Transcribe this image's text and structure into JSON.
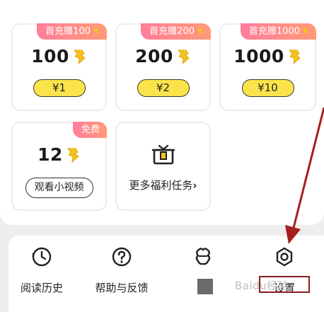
{
  "recharge_cards": [
    {
      "badge": "首充赠100",
      "amount": "100",
      "price": "¥1"
    },
    {
      "badge": "首充赠200",
      "amount": "200",
      "price": "¥2"
    },
    {
      "badge": "首充赠1000",
      "amount": "1000",
      "price": "¥10"
    }
  ],
  "video_card": {
    "badge": "免费",
    "amount": "12",
    "button": "观看小视频"
  },
  "tasks_card": {
    "label": "更多福利任务",
    "chevron": "›"
  },
  "bottom_nav": [
    {
      "label": "阅读历史",
      "icon": "history-icon"
    },
    {
      "label": "帮助与反馈",
      "icon": "help-icon"
    },
    {
      "label": "",
      "icon": "skin-icon"
    },
    {
      "label": "设置",
      "icon": "settings-icon"
    }
  ],
  "annotation": {
    "watermark": "Baidu经验",
    "arrow_color": "#a81e1e",
    "box_color": "#8a1c1c"
  },
  "colors": {
    "badge_gradient": [
      "#ff7e9a",
      "#ff9a78"
    ],
    "coin": "#f5c21b",
    "button_yellow": "#fbe44b"
  }
}
